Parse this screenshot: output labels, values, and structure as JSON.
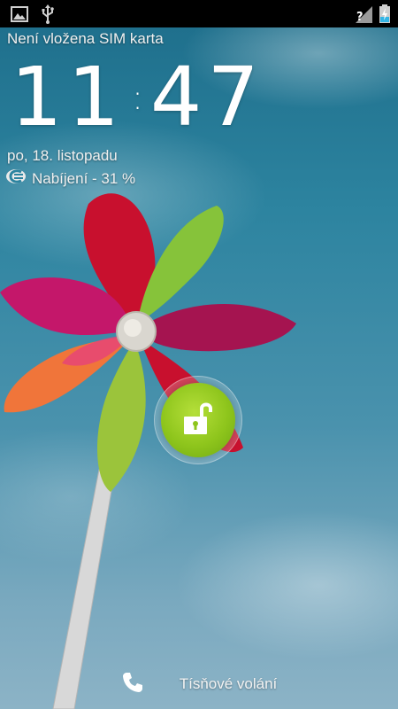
{
  "status_bar": {
    "left_icons": [
      "image-icon",
      "usb-icon"
    ],
    "right_icons": [
      "signal-no-sim-icon",
      "battery-charging-icon"
    ]
  },
  "lockscreen": {
    "sim_status": "Není vložena SIM karta",
    "clock": {
      "hours": "11",
      "separator": ":",
      "minutes": "47"
    },
    "date": "po, 18. listopadu",
    "charging_text": "Nabíjení - 31 %",
    "charging_icon": "charger-plug-icon",
    "unlock_icon": "unlock-padlock-icon",
    "emergency": {
      "icon": "phone-icon",
      "label": "Tísňové volání"
    }
  },
  "colors": {
    "unlock_green": "#8ec51c",
    "status_bar": "#000000"
  }
}
